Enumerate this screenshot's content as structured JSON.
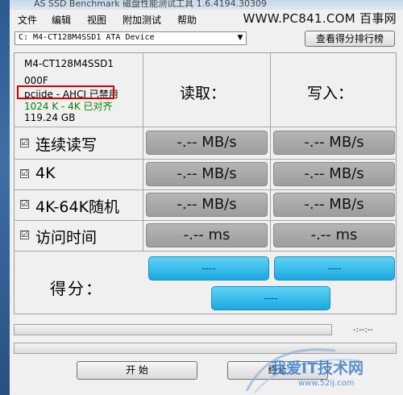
{
  "window": {
    "title": "AS SSD Benchmark 磁盘性能测试工具 1.6.4194.30309"
  },
  "menu": {
    "file": "文件",
    "edit": "编辑",
    "view": "视图",
    "tools": "附加测试",
    "help": "帮助"
  },
  "watermark_top": "WWW.PC841.COM 百事网",
  "drive_select": {
    "value": "C: M4-CT128M4SSD1 ATA Device"
  },
  "rank_button": "查看得分排行榜",
  "drive_info": {
    "model": "M4-CT128M4SSD1",
    "firmware": "000F",
    "driver": "pciide - AHCI 已禁用",
    "alignment": "1024 K - 4K 已对齐",
    "capacity": "119.24 GB"
  },
  "columns": {
    "read": "读取：",
    "write": "写入："
  },
  "tests": [
    {
      "label": "连续读写",
      "checked": "☑",
      "read": "-.-- MB/s",
      "write": "-.-- MB/s"
    },
    {
      "label": "4K",
      "checked": "☑",
      "read": "-.-- MB/s",
      "write": "-.-- MB/s"
    },
    {
      "label": "4K-64K随机",
      "checked": "☑",
      "read": "-.-- MB/s",
      "write": "-.-- MB/s"
    },
    {
      "label": "访问时间",
      "checked": "☑",
      "read": "-.-- ms",
      "write": "-.-- ms"
    }
  ],
  "score": {
    "label": "得分：",
    "read": "----",
    "write": "----",
    "total": "----"
  },
  "progress": {
    "time": "-:--:--",
    "percent_top": 0,
    "percent_bottom": 0
  },
  "buttons": {
    "start": "开 始",
    "abort": "终止"
  },
  "watermark_bottom": {
    "name": "我爱IT技术网",
    "url": "www.52ij.com"
  },
  "colors": {
    "score_blue": "#19a8df",
    "result_gray": "#a8a8a8",
    "alert_red": "#d40000",
    "aligned_green": "#008000"
  }
}
